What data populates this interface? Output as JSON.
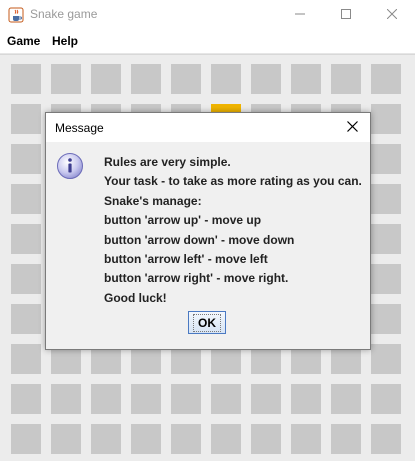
{
  "window": {
    "title": "Snake game",
    "icon": "java-coffee-cup-icon",
    "controls": [
      "minimize-icon",
      "maximize-icon",
      "close-icon"
    ]
  },
  "menu": {
    "items": [
      {
        "label": "Game"
      },
      {
        "label": "Help"
      }
    ]
  },
  "board": {
    "columns": 10,
    "rows": 10,
    "food_cell": {
      "col": 5,
      "row": 1
    },
    "colors": {
      "background": "#ececec",
      "cell": "#c8c8c8",
      "food": "#f0b400"
    }
  },
  "dialog": {
    "title": "Message",
    "icon": "info-icon",
    "lines": [
      "Rules are very simple.",
      "Your task - to take as more rating as you can.",
      "Snake's manage:",
      "button 'arrow up' - move up",
      "button 'arrow down' - move down",
      "button 'arrow left' - move left",
      "button 'arrow right' - move right.",
      "Good luck!"
    ],
    "ok_label": "OK"
  }
}
